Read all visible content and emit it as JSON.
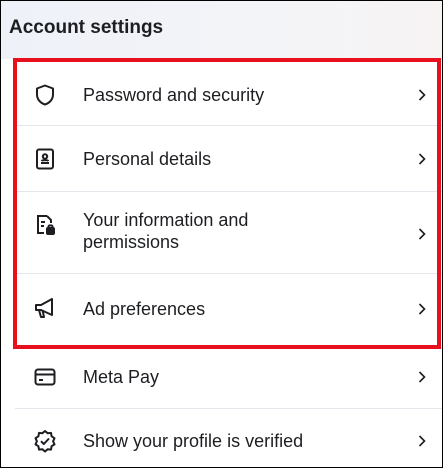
{
  "header": {
    "title": "Account settings"
  },
  "menu": {
    "items": [
      {
        "label": "Password and security",
        "icon": "shield-icon"
      },
      {
        "label": "Personal details",
        "icon": "id-badge-icon"
      },
      {
        "label": "Your information and\npermissions",
        "icon": "document-lock-icon"
      },
      {
        "label": "Ad preferences",
        "icon": "megaphone-icon"
      },
      {
        "label": "Meta Pay",
        "icon": "credit-card-icon"
      },
      {
        "label": "Show your profile is verified",
        "icon": "verified-badge-icon"
      }
    ],
    "chevron_icon": "chevron-right-icon"
  },
  "colors": {
    "highlight": "#e8101c",
    "divider": "#e4e6eb",
    "text": "#1c1e21"
  }
}
